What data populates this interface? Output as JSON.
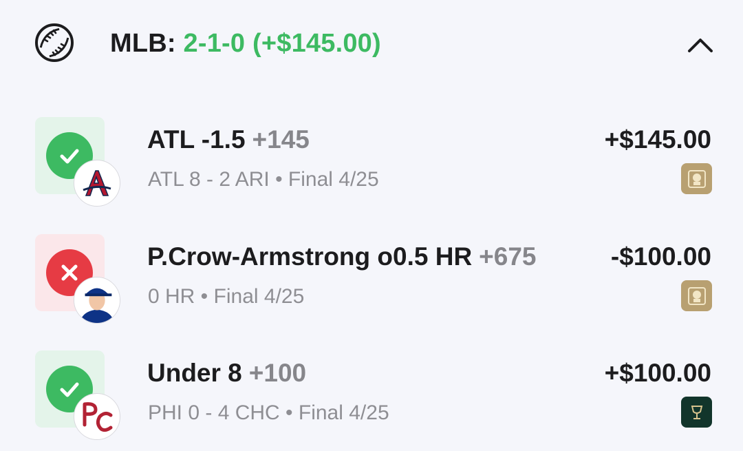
{
  "header": {
    "icon": "baseball-icon",
    "league": "MLB:",
    "record": "2-1-0 (+$145.00)",
    "collapse_icon": "chevron-up-icon",
    "record_color": "#3dba62"
  },
  "bets": [
    {
      "status": "win",
      "team_badge": "braves-logo",
      "title": "ATL -1.5",
      "odds": "+145",
      "subtitle": "ATL 8 - 2 ARI • Final 4/25",
      "amount": "+$145.00",
      "sportsbook_icon": "gold-book-icon"
    },
    {
      "status": "loss",
      "team_badge": "player-headshot",
      "title": "P.Crow-Armstrong o0.5 HR",
      "odds": "+675",
      "subtitle": "0 HR • Final 4/25",
      "amount": "-$100.00",
      "sportsbook_icon": "gold-book-icon"
    },
    {
      "status": "win",
      "team_badge": "phillies-logo",
      "title": "Under 8",
      "odds": "+100",
      "subtitle": "PHI 0 - 4 CHC • Final 4/25",
      "amount": "+$100.00",
      "sportsbook_icon": "dark-book-icon"
    }
  ],
  "colors": {
    "win": "#3dba62",
    "loss": "#e63b44",
    "win_bg": "#e4f4ea",
    "loss_bg": "#fbe7ea"
  }
}
